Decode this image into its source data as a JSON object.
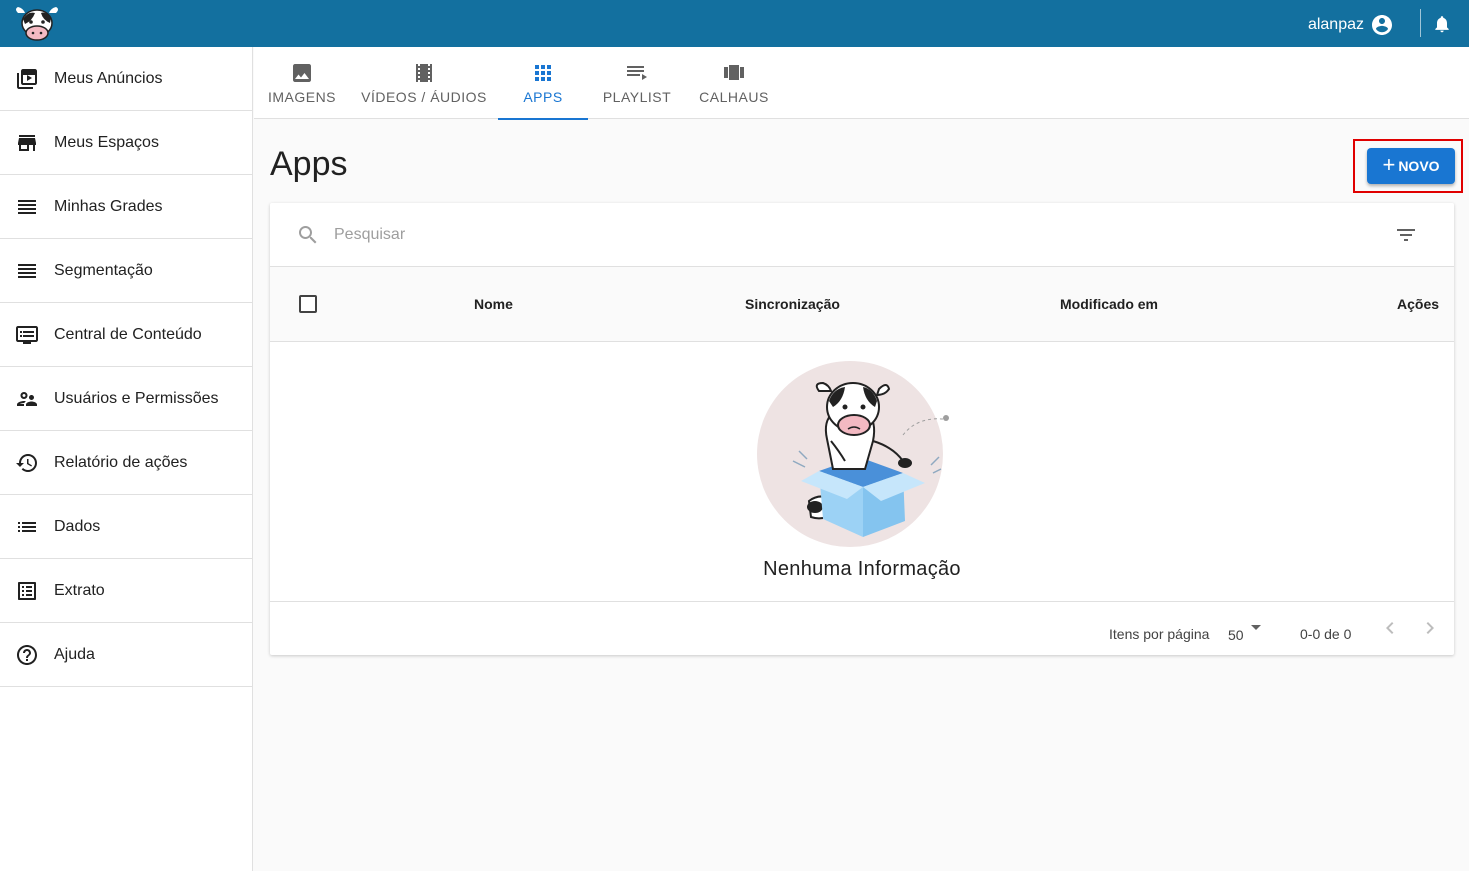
{
  "header": {
    "username": "alanpaz",
    "bg_color": "#13709f"
  },
  "sidebar": {
    "items": [
      {
        "label": "Meus Anúncios",
        "icon": "ads-stack-icon"
      },
      {
        "label": "Meus Espaços",
        "icon": "store-icon"
      },
      {
        "label": "Minhas Grades",
        "icon": "list-lines-icon"
      },
      {
        "label": "Segmentação",
        "icon": "list-lines-icon"
      },
      {
        "label": "Central de Conteúdo",
        "icon": "content-screen-icon"
      },
      {
        "label": "Usuários e Permissões",
        "icon": "people-icon"
      },
      {
        "label": "Relatório de ações",
        "icon": "history-icon"
      },
      {
        "label": "Dados",
        "icon": "bullet-list-icon"
      },
      {
        "label": "Extrato",
        "icon": "statement-icon"
      },
      {
        "label": "Ajuda",
        "icon": "help-circle-icon"
      }
    ]
  },
  "tabs": [
    {
      "label": "IMAGENS",
      "icon": "image-icon",
      "active": false
    },
    {
      "label": "VÍDEOS / ÁUDIOS",
      "icon": "film-icon",
      "active": false
    },
    {
      "label": "APPS",
      "icon": "apps-grid-icon",
      "active": true
    },
    {
      "label": "PLAYLIST",
      "icon": "playlist-play-icon",
      "active": false
    },
    {
      "label": "CALHAUS",
      "icon": "view-carousel-icon",
      "active": false
    }
  ],
  "page": {
    "title": "Apps",
    "new_button_label": "NOVO",
    "new_button_plus": "+",
    "accent_color": "#1976d2"
  },
  "table": {
    "search_placeholder": "Pesquisar",
    "columns": [
      "Nome",
      "Sincronização",
      "Modificado em",
      "Ações"
    ],
    "empty_text": "Nenhuma Informação",
    "per_page_label": "Itens por página",
    "per_page_value": "50",
    "range_text": "0-0 de 0"
  }
}
